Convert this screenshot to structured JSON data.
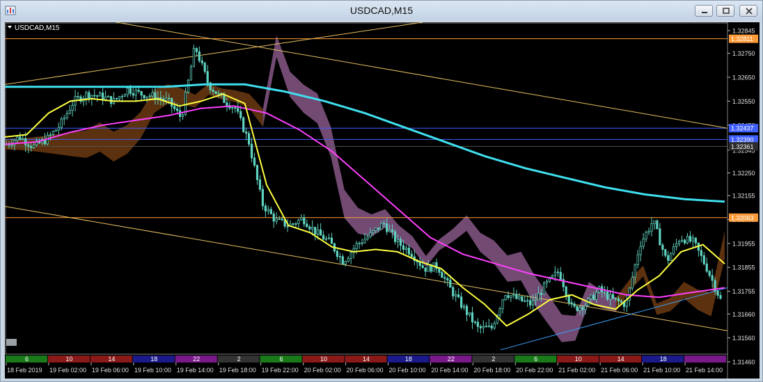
{
  "window": {
    "title": "USDCAD,M15"
  },
  "chart": {
    "symbol_label": "USDCAD,M15",
    "colors": {
      "background": "#000000",
      "candle": "#5fd3c0",
      "ma_fast": "#ffff40",
      "ma_mid": "#ff40ff",
      "ma_slow": "#40e0f0",
      "cloud_bear": "#8e5c8e",
      "cloud_bull": "#6b3a12",
      "hline_orange": "#ff9c3a",
      "hline_blue": "#4060ff",
      "trendline_yellow": "#e8c060",
      "trendline_blue": "#3aa0ff"
    }
  },
  "chart_data": {
    "type": "candlestick",
    "price_axis": {
      "ticks": [
        "1.32845",
        "1.32750",
        "1.32650",
        "1.32550",
        "1.32450",
        "1.32345",
        "1.32250",
        "1.32155",
        "1.32055",
        "1.31955",
        "1.31855",
        "1.31755",
        "1.31660",
        "1.31560",
        "1.31460"
      ],
      "ylim": [
        1.3146,
        1.32845
      ]
    },
    "price_labels": [
      {
        "price": 1.32811,
        "text": "1.32811",
        "color": "#ff9c3a"
      },
      {
        "price": 1.32437,
        "text": "1.32437",
        "color": "#4060ff"
      },
      {
        "price": 1.3239,
        "text": "1.32390",
        "color": "#4060ff"
      },
      {
        "price": 1.32361,
        "text": "1.32361",
        "color": "#2c2c2c"
      },
      {
        "price": 1.32063,
        "text": "1.32063",
        "color": "#ff9c3a"
      }
    ],
    "time_axis": [
      "18 Feb 2019",
      "19 Feb 02:00",
      "19 Feb 06:00",
      "19 Feb 10:00",
      "19 Feb 14:00",
      "19 Feb 18:00",
      "19 Feb 22:00",
      "20 Feb 02:00",
      "20 Feb 06:00",
      "20 Feb 10:00",
      "20 Feb 14:00",
      "20 Feb 18:00",
      "20 Feb 22:00",
      "21 Feb 02:00",
      "21 Feb 06:00",
      "21 Feb 10:00",
      "21 Feb 14:00"
    ],
    "session_bar": [
      {
        "label": "6",
        "color": "#1a7a1a"
      },
      {
        "label": "10",
        "color": "#8a1a1a"
      },
      {
        "label": "14",
        "color": "#8a1a1a"
      },
      {
        "label": "18",
        "color": "#1a1a8a"
      },
      {
        "label": "22",
        "color": "#7a1a8a"
      },
      {
        "label": "2",
        "color": "#333333"
      },
      {
        "label": "6",
        "color": "#1a7a1a"
      },
      {
        "label": "10",
        "color": "#8a1a1a"
      },
      {
        "label": "14",
        "color": "#8a1a1a"
      },
      {
        "label": "18",
        "color": "#1a1a8a"
      },
      {
        "label": "22",
        "color": "#7a1a8a"
      },
      {
        "label": "2",
        "color": "#333333"
      },
      {
        "label": "6",
        "color": "#1a7a1a"
      },
      {
        "label": "10",
        "color": "#8a1a1a"
      },
      {
        "label": "14",
        "color": "#8a1a1a"
      },
      {
        "label": "18",
        "color": "#1a1a8a"
      },
      {
        "label": "",
        "color": "#7a1a8a"
      }
    ],
    "close_path": [
      1.3237,
      1.324,
      1.3236,
      1.3239,
      1.3245,
      1.3255,
      1.3258,
      1.3257,
      1.3255,
      1.326,
      1.3258,
      1.3257,
      1.3255,
      1.3248,
      1.3278,
      1.3262,
      1.3256,
      1.3252,
      1.3238,
      1.3212,
      1.3205,
      1.3203,
      1.3206,
      1.32,
      1.3196,
      1.3188,
      1.3195,
      1.3199,
      1.3204,
      1.3196,
      1.3192,
      1.3185,
      1.3186,
      1.3176,
      1.3168,
      1.316,
      1.316,
      1.3175,
      1.3172,
      1.317,
      1.3178,
      1.3184,
      1.3168,
      1.317,
      1.3176,
      1.3172,
      1.317,
      1.3195,
      1.3205,
      1.3188,
      1.3198,
      1.3196,
      1.3185,
      1.3172
    ],
    "ma_fast": [
      1.324,
      1.3241,
      1.325,
      1.3255,
      1.3256,
      1.3255,
      1.3255,
      1.3256,
      1.3253,
      1.3255,
      1.3258,
      1.3254,
      1.322,
      1.3203,
      1.32,
      1.3194,
      1.3192,
      1.3193,
      1.3192,
      1.3188,
      1.3185,
      1.3177,
      1.317,
      1.3161,
      1.3166,
      1.3172,
      1.3174,
      1.317,
      1.3168,
      1.3176,
      1.3182,
      1.3192,
      1.3195,
      1.3187
    ],
    "ma_mid": [
      1.3237,
      1.3238,
      1.3242,
      1.3245,
      1.3247,
      1.3249,
      1.3252,
      1.3253,
      1.325,
      1.3243,
      1.3234,
      1.3222,
      1.321,
      1.3198,
      1.3191,
      1.3187,
      1.3183,
      1.318,
      1.3177,
      1.3174,
      1.3173,
      1.3175,
      1.3177
    ],
    "ma_slow": [
      1.3261,
      1.3261,
      1.3261,
      1.3261,
      1.3261,
      1.3262,
      1.3262,
      1.3259,
      1.3255,
      1.325,
      1.3244,
      1.3238,
      1.3232,
      1.3227,
      1.3223,
      1.3219,
      1.3216,
      1.3214,
      1.3213
    ]
  }
}
